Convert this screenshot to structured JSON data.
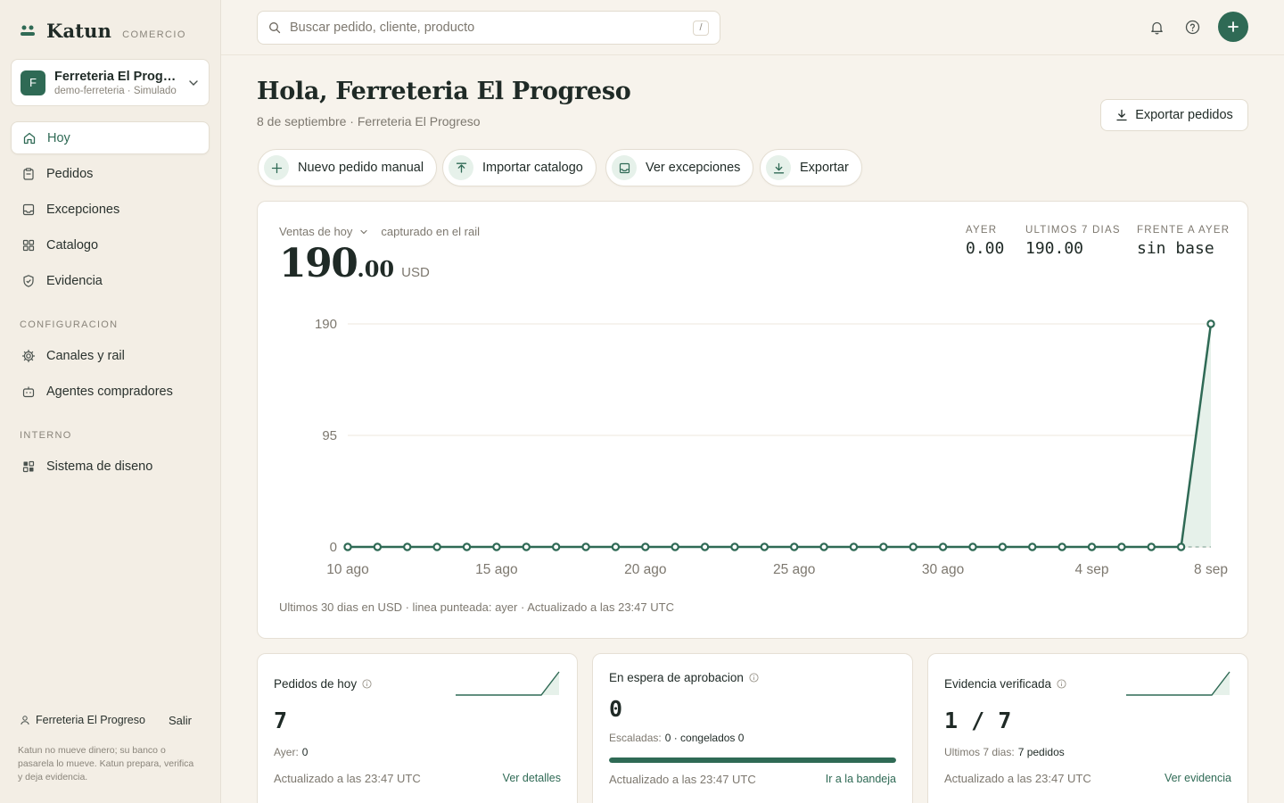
{
  "brand": {
    "name": "Katun",
    "tag": "COMERCIO"
  },
  "org": {
    "initial": "F",
    "name": "Ferreteria El Progreso",
    "sub": "demo-ferreteria · Simulado"
  },
  "nav": {
    "main": [
      {
        "label": "Hoy",
        "icon": "home-icon",
        "active": true
      },
      {
        "label": "Pedidos",
        "icon": "clipboard-icon"
      },
      {
        "label": "Excepciones",
        "icon": "inbox-icon"
      },
      {
        "label": "Catalogo",
        "icon": "grid-icon"
      },
      {
        "label": "Evidencia",
        "icon": "shield-check-icon"
      }
    ],
    "config_label": "CONFIGURACION",
    "config": [
      {
        "label": "Canales y rail",
        "icon": "gear-icon"
      },
      {
        "label": "Agentes compradores",
        "icon": "bot-icon"
      }
    ],
    "internal_label": "INTERNO",
    "internal": [
      {
        "label": "Sistema de diseno",
        "icon": "components-icon"
      }
    ]
  },
  "footer": {
    "user": "Ferreteria El Progreso",
    "logout": "Salir",
    "note": "Katun no mueve dinero; su banco o pasarela lo mueve. Katun prepara, verifica y deja evidencia."
  },
  "search": {
    "placeholder": "Buscar pedido, cliente, producto",
    "shortcut": "/"
  },
  "header": {
    "greeting": "Hola, Ferreteria El Progreso",
    "subtitle": "8 de septiembre · Ferreteria El Progreso",
    "export_label": "Exportar pedidos"
  },
  "quick_actions": [
    {
      "label": "Nuevo pedido manual",
      "icon": "plus-icon"
    },
    {
      "label": "Importar catalogo",
      "icon": "upload-icon"
    },
    {
      "label": "Ver excepciones",
      "icon": "inbox-icon"
    },
    {
      "label": "Exportar",
      "icon": "download-icon"
    }
  ],
  "sales": {
    "metric": "Ventas de hoy",
    "metric_note": "capturado en el rail",
    "value_int": "190",
    "value_dec": ".00",
    "currency": "USD",
    "kpis": [
      {
        "label": "AYER",
        "value": "0.00"
      },
      {
        "label": "ULTIMOS 7 DIAS",
        "value": "190.00"
      },
      {
        "label": "FRENTE A AYER",
        "value": "sin base"
      }
    ],
    "footnote": "Ultimos 30 dias en USD · linea punteada: ayer · Actualizado a las 23:47 UTC"
  },
  "chart_data": {
    "type": "line",
    "ylim": [
      0,
      190
    ],
    "yticks": [
      0,
      95,
      190
    ],
    "xticks": [
      {
        "label": "10 ago",
        "index": 0
      },
      {
        "label": "15 ago",
        "index": 5
      },
      {
        "label": "20 ago",
        "index": 10
      },
      {
        "label": "25 ago",
        "index": 15
      },
      {
        "label": "30 ago",
        "index": 20
      },
      {
        "label": "4 sep",
        "index": 25
      },
      {
        "label": "8 sep",
        "index": 29
      }
    ],
    "series": [
      {
        "values": [
          0,
          0,
          0,
          0,
          0,
          0,
          0,
          0,
          0,
          0,
          0,
          0,
          0,
          0,
          0,
          0,
          0,
          0,
          0,
          0,
          0,
          0,
          0,
          0,
          0,
          0,
          0,
          0,
          0,
          190
        ]
      }
    ],
    "color": "#2f6a55"
  },
  "cards": [
    {
      "title": "Pedidos de hoy",
      "value": "7",
      "sub_label": "Ayer:",
      "sub_value": "0",
      "updated": "Actualizado a las 23:47 UTC",
      "link": "Ver detalles"
    },
    {
      "title": "En espera de aprobacion",
      "value": "0",
      "sub_label": "Escaladas:",
      "sub_value": "0 · congelados 0",
      "updated": "Actualizado a las 23:47 UTC",
      "link": "Ir a la bandeja",
      "progress": 1.0
    },
    {
      "title": "Evidencia verificada",
      "value": "1 / 7",
      "sub_label": "Ultimos 7 dias:",
      "sub_value": "7 pedidos",
      "updated": "Actualizado a las 23:47 UTC",
      "link": "Ver evidencia"
    }
  ]
}
